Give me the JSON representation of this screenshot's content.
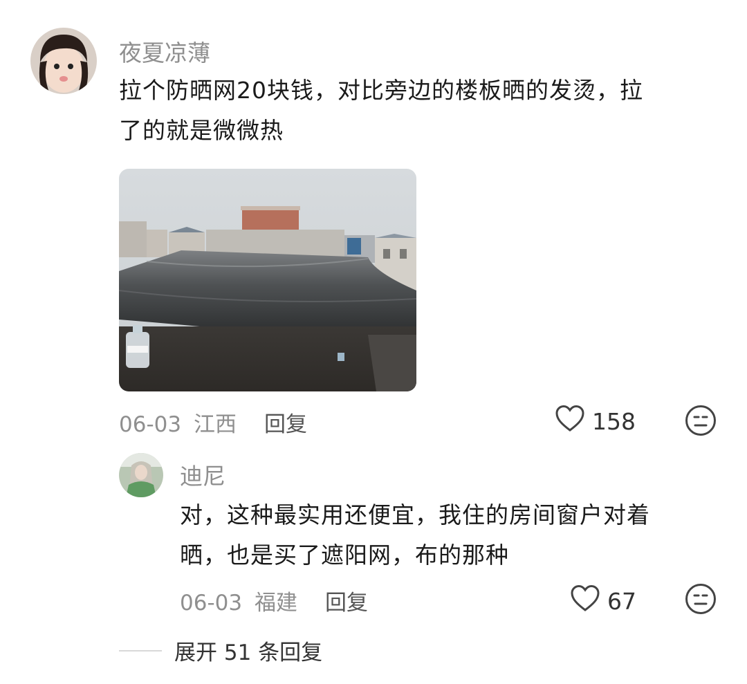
{
  "comment": {
    "username": "夜夏凉薄",
    "text_line1": "拉个防晒网20块钱，对比旁边的楼板晒的发烫，拉",
    "text_line2": "了的就是微微热",
    "date": "06-03",
    "location": "江西",
    "reply_label": "回复",
    "likes": "158"
  },
  "reply": {
    "username": "迪尼",
    "text_line1": "对，这种最实用还便宜，我住的房间窗户对着",
    "text_line2": "晒，也是买了遮阳网，布的那种",
    "date": "06-03",
    "location": "福建",
    "reply_label": "回复",
    "likes": "67"
  },
  "expand_replies": "展开 51 条回复",
  "icons": {
    "like": "heart-outline-icon",
    "reaction": "neutral-face-icon"
  },
  "colors": {
    "username": "#8f8f8f",
    "meta": "#8f8f8f",
    "text": "#1a1a1a"
  }
}
